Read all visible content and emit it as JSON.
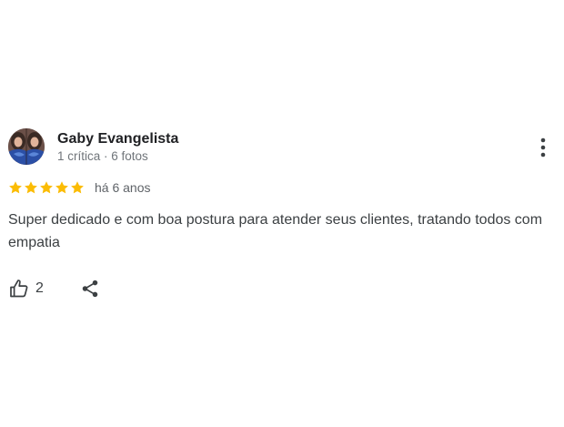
{
  "review": {
    "author_name": "Gaby Evangelista",
    "author_meta": "1 crítica · 6 fotos",
    "rating": 5,
    "rating_max": 5,
    "date": "há 6 anos",
    "text": "Super dedicado e com boa postura para atender seus clientes, tratando todos com empatia",
    "likes": "2"
  },
  "icons": {
    "menu": "more-vert-icon",
    "like": "thumbs-up-icon",
    "share": "share-icon",
    "star": "star-icon"
  },
  "colors": {
    "star": "#fbbc04",
    "name": "#202124",
    "meta": "#70757a",
    "text": "#3c4043",
    "icon": "#3c4043"
  }
}
